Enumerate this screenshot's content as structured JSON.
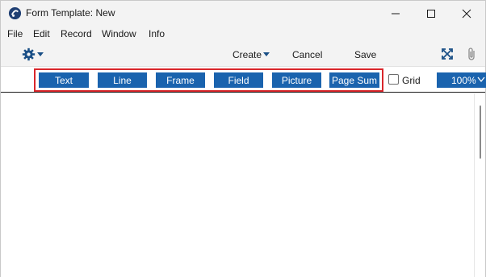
{
  "window": {
    "title": "Form Template: New"
  },
  "menu": {
    "items": [
      "File",
      "Edit",
      "Record",
      "Window",
      "Info"
    ]
  },
  "actions": {
    "create": "Create",
    "cancel": "Cancel",
    "save": "Save"
  },
  "form_toolbar": {
    "buttons": [
      "Text",
      "Line",
      "Frame",
      "Field",
      "Picture",
      "Page Sum"
    ],
    "grid_label": "Grid",
    "grid_checked": false,
    "zoom": "100%"
  },
  "icons": {
    "app": "app-logo-icon",
    "minimize": "minimize-icon",
    "maximize": "maximize-icon",
    "close": "close-icon",
    "settings": "gear-icon",
    "expand": "expand-icon",
    "attach": "paperclip-icon"
  },
  "colors": {
    "tool_button": "#1a63ae",
    "highlight_border": "#d9262b",
    "chrome_background": "#f3f3f3"
  }
}
